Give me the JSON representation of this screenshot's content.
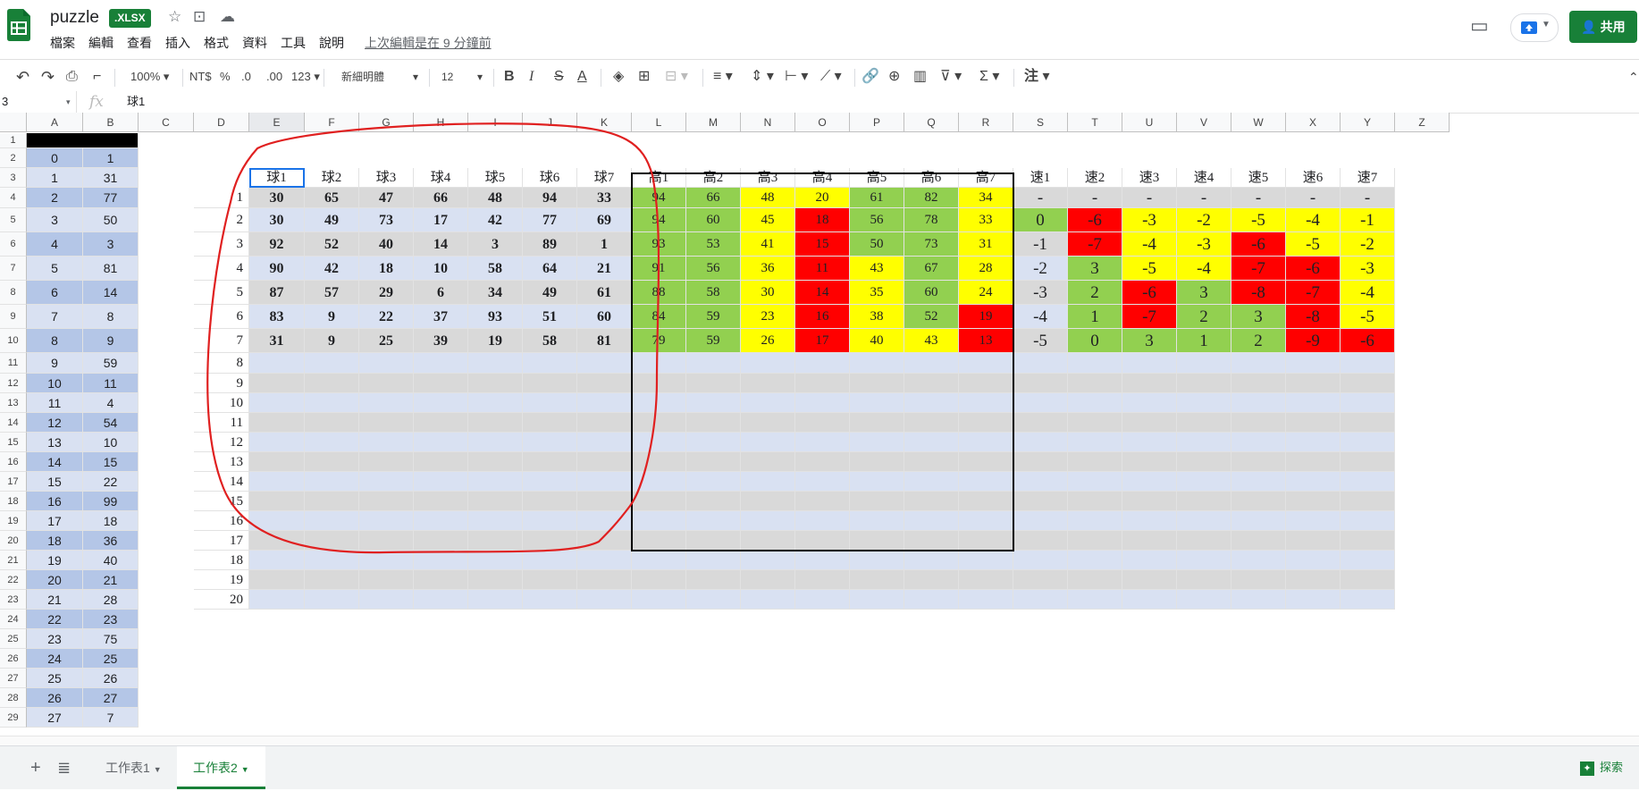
{
  "app": {
    "title": "puzzle",
    "badge": "XLSX",
    "menu": [
      "檔案",
      "編輯",
      "查看",
      "插入",
      "格式",
      "資料",
      "工具",
      "說明"
    ],
    "last_edit": "上次編輯是在 9 分鐘前",
    "share_label": "共用"
  },
  "toolbar": {
    "zoom": "100%",
    "currency": "NT$",
    "percent": "%",
    "dec_decrease": ".0",
    "dec_increase": ".00",
    "format_more": "123",
    "font": "新細明體",
    "font_size": "12",
    "bold": "B",
    "italic": "I",
    "strike": "S",
    "text_color": "A",
    "sum": "Σ",
    "input_tools": "注"
  },
  "formula": {
    "namebox": "3",
    "fx": "fx",
    "value": "球1"
  },
  "columns": [
    "A",
    "B",
    "C",
    "D",
    "E",
    "F",
    "G",
    "H",
    "I",
    "J",
    "K",
    "L",
    "M",
    "N",
    "O",
    "P",
    "Q",
    "R",
    "S",
    "T",
    "U",
    "V",
    "W",
    "X",
    "Y",
    "Z"
  ],
  "rows": [
    "1",
    "2",
    "3",
    "4",
    "5",
    "6",
    "7",
    "8",
    "9",
    "10",
    "11",
    "12",
    "13",
    "14",
    "15",
    "16",
    "17",
    "18",
    "19",
    "20",
    "21",
    "22",
    "23",
    "24",
    "25",
    "26",
    "27",
    "28",
    "29"
  ],
  "left_table": [
    [
      "0",
      "1"
    ],
    [
      "1",
      "31"
    ],
    [
      "2",
      "77"
    ],
    [
      "3",
      "50"
    ],
    [
      "4",
      "3"
    ],
    [
      "5",
      "81"
    ],
    [
      "6",
      "14"
    ],
    [
      "7",
      "8"
    ],
    [
      "8",
      "9"
    ],
    [
      "9",
      "59"
    ],
    [
      "10",
      "11"
    ],
    [
      "11",
      "4"
    ],
    [
      "12",
      "54"
    ],
    [
      "13",
      "10"
    ],
    [
      "14",
      "15"
    ],
    [
      "15",
      "22"
    ],
    [
      "16",
      "99"
    ],
    [
      "17",
      "18"
    ],
    [
      "18",
      "36"
    ],
    [
      "19",
      "40"
    ],
    [
      "20",
      "21"
    ],
    [
      "21",
      "28"
    ],
    [
      "22",
      "23"
    ],
    [
      "23",
      "75"
    ],
    [
      "24",
      "25"
    ],
    [
      "25",
      "26"
    ],
    [
      "26",
      "27"
    ],
    [
      "27",
      "7"
    ]
  ],
  "row_labels": [
    "1",
    "2",
    "3",
    "4",
    "5",
    "6",
    "7",
    "8",
    "9",
    "10",
    "11",
    "12",
    "13",
    "14",
    "15",
    "16",
    "17",
    "18",
    "19",
    "20"
  ],
  "ball_headers": [
    "球1",
    "球2",
    "球3",
    "球4",
    "球5",
    "球6",
    "球7"
  ],
  "high_headers": [
    "高1",
    "高2",
    "高3",
    "高4",
    "高5",
    "高6",
    "高7"
  ],
  "speed_headers": [
    "速1",
    "速2",
    "速3",
    "速4",
    "速5",
    "速6",
    "速7"
  ],
  "balls": [
    [
      "30",
      "65",
      "47",
      "66",
      "48",
      "94",
      "33"
    ],
    [
      "30",
      "49",
      "73",
      "17",
      "42",
      "77",
      "69"
    ],
    [
      "92",
      "52",
      "40",
      "14",
      "3",
      "89",
      "1"
    ],
    [
      "90",
      "42",
      "18",
      "10",
      "58",
      "64",
      "21"
    ],
    [
      "87",
      "57",
      "29",
      "6",
      "34",
      "49",
      "61"
    ],
    [
      "83",
      "9",
      "22",
      "37",
      "93",
      "51",
      "60"
    ],
    [
      "31",
      "9",
      "25",
      "39",
      "19",
      "58",
      "81"
    ]
  ],
  "highs": [
    [
      "94",
      "66",
      "48",
      "20",
      "61",
      "82",
      "34"
    ],
    [
      "94",
      "60",
      "45",
      "18",
      "56",
      "78",
      "33"
    ],
    [
      "93",
      "53",
      "41",
      "15",
      "50",
      "73",
      "31"
    ],
    [
      "91",
      "56",
      "36",
      "11",
      "43",
      "67",
      "28"
    ],
    [
      "88",
      "58",
      "30",
      "14",
      "35",
      "60",
      "24"
    ],
    [
      "84",
      "59",
      "23",
      "16",
      "38",
      "52",
      "19"
    ],
    [
      "79",
      "59",
      "26",
      "17",
      "40",
      "43",
      "13"
    ]
  ],
  "high_colors": [
    [
      "g",
      "g",
      "y",
      "y",
      "g",
      "g",
      "y"
    ],
    [
      "g",
      "g",
      "y",
      "r",
      "g",
      "g",
      "y"
    ],
    [
      "g",
      "g",
      "y",
      "r",
      "g",
      "g",
      "y"
    ],
    [
      "g",
      "g",
      "y",
      "r",
      "y",
      "g",
      "y"
    ],
    [
      "g",
      "g",
      "y",
      "r",
      "y",
      "g",
      "y"
    ],
    [
      "g",
      "g",
      "y",
      "r",
      "y",
      "g",
      "r"
    ],
    [
      "g",
      "g",
      "y",
      "r",
      "y",
      "y",
      "r"
    ]
  ],
  "speeds": [
    [
      "-",
      "-",
      "-",
      "-",
      "-",
      "-",
      "-"
    ],
    [
      "0",
      "-6",
      "-3",
      "-2",
      "-5",
      "-4",
      "-1"
    ],
    [
      "-1",
      "-7",
      "-4",
      "-3",
      "-6",
      "-5",
      "-2"
    ],
    [
      "-2",
      "3",
      "-5",
      "-4",
      "-7",
      "-6",
      "-3"
    ],
    [
      "-3",
      "2",
      "-6",
      "3",
      "-8",
      "-7",
      "-4"
    ],
    [
      "-4",
      "1",
      "-7",
      "2",
      "3",
      "-8",
      "-5"
    ],
    [
      "-5",
      "0",
      "3",
      "1",
      "2",
      "-9",
      "-6"
    ]
  ],
  "speed_colors": [
    [
      "n",
      "n",
      "n",
      "n",
      "n",
      "n",
      "n"
    ],
    [
      "g",
      "r",
      "y",
      "y",
      "y",
      "y",
      "y"
    ],
    [
      "n",
      "r",
      "y",
      "y",
      "r",
      "y",
      "y"
    ],
    [
      "n",
      "g",
      "y",
      "y",
      "r",
      "r",
      "y"
    ],
    [
      "n",
      "g",
      "r",
      "g",
      "r",
      "r",
      "y"
    ],
    [
      "n",
      "g",
      "r",
      "g",
      "g",
      "r",
      "y"
    ],
    [
      "n",
      "g",
      "g",
      "g",
      "g",
      "r",
      "r"
    ]
  ],
  "colors": {
    "green": "#92d050",
    "yellow": "#ffff00",
    "red": "#ff0000",
    "blue_band": "#d9e1f2",
    "blue_dark": "#b4c6e7",
    "gray_band": "#d9d9d9",
    "annotation": "#e02020"
  },
  "sheets": [
    "工作表1",
    "工作表2"
  ],
  "explore_label": "探索"
}
